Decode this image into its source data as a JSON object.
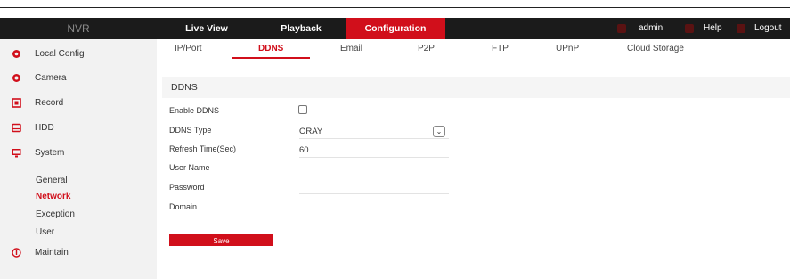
{
  "app": {
    "logo": "NVR"
  },
  "nav": {
    "tabs": [
      {
        "label": "Live View"
      },
      {
        "label": "Playback"
      },
      {
        "label": "Configuration"
      }
    ],
    "user": "admin",
    "help": "Help",
    "logout": "Logout"
  },
  "sidebar": {
    "items": [
      {
        "label": "Local Config",
        "icon": "settings-icon"
      },
      {
        "label": "Camera",
        "icon": "camera-icon"
      },
      {
        "label": "Record",
        "icon": "record-icon"
      },
      {
        "label": "HDD",
        "icon": "hdd-icon"
      },
      {
        "label": "System",
        "icon": "monitor-icon"
      },
      {
        "label": "Maintain",
        "icon": "maintain-icon"
      }
    ],
    "system_sub": [
      {
        "label": "General"
      },
      {
        "label": "Network"
      },
      {
        "label": "Exception"
      },
      {
        "label": "User"
      }
    ]
  },
  "subtabs": [
    {
      "label": "IP/Port"
    },
    {
      "label": "DDNS"
    },
    {
      "label": "Email"
    },
    {
      "label": "P2P"
    },
    {
      "label": "FTP"
    },
    {
      "label": "UPnP"
    },
    {
      "label": "Cloud Storage"
    }
  ],
  "section": {
    "title": "DDNS"
  },
  "form": {
    "enable_label": "Enable DDNS",
    "type_label": "DDNS Type",
    "type_value": "ORAY",
    "refresh_label": "Refresh Time(Sec)",
    "refresh_value": "60",
    "username_label": "User Name",
    "password_label": "Password",
    "domain_label": "Domain",
    "save_label": "Save"
  },
  "colors": {
    "accent": "#d10f1b",
    "navbar": "#1b1b1b",
    "sidebar": "#f2f2f2"
  }
}
